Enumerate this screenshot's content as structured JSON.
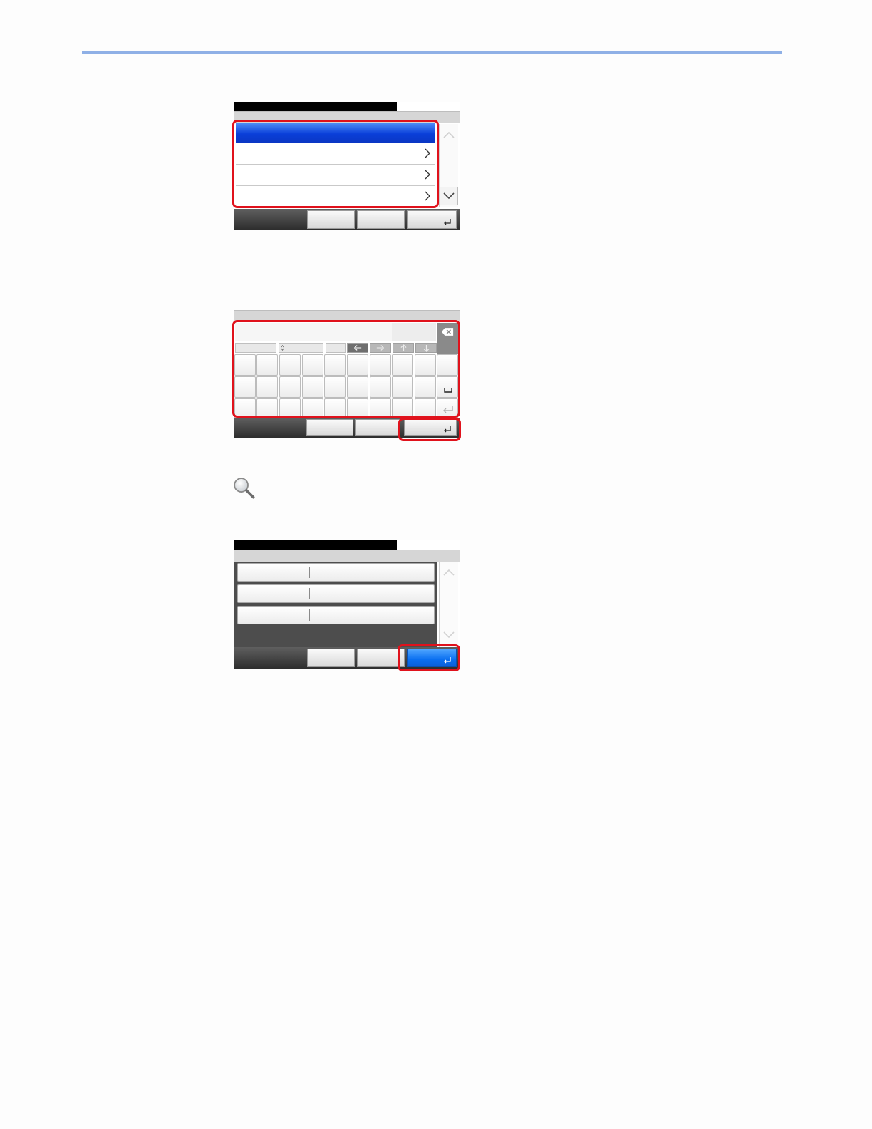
{
  "page": {
    "accent_rule_color": "#8fb0e6",
    "highlight_color": "#e0121c",
    "selected_color": "#0a3fd9"
  },
  "panel_list": {
    "rows": [
      {
        "selected": true
      },
      {
        "selected": false
      },
      {
        "selected": false
      },
      {
        "selected": false
      }
    ],
    "icons": [
      "chevron-right-icon",
      "scroll-up-icon",
      "scroll-down-icon",
      "enter-icon"
    ]
  },
  "panel_keyboard": {
    "icons": [
      "backspace-icon",
      "arrow-left-icon",
      "arrow-right-icon",
      "arrow-up-icon",
      "arrow-down-icon",
      "space-icon",
      "enter-icon"
    ]
  },
  "hint": {
    "icon": "magnifier-icon"
  },
  "panel_confirm": {
    "rows": 3,
    "icons": [
      "scroll-up-icon",
      "scroll-down-icon",
      "enter-icon"
    ]
  }
}
